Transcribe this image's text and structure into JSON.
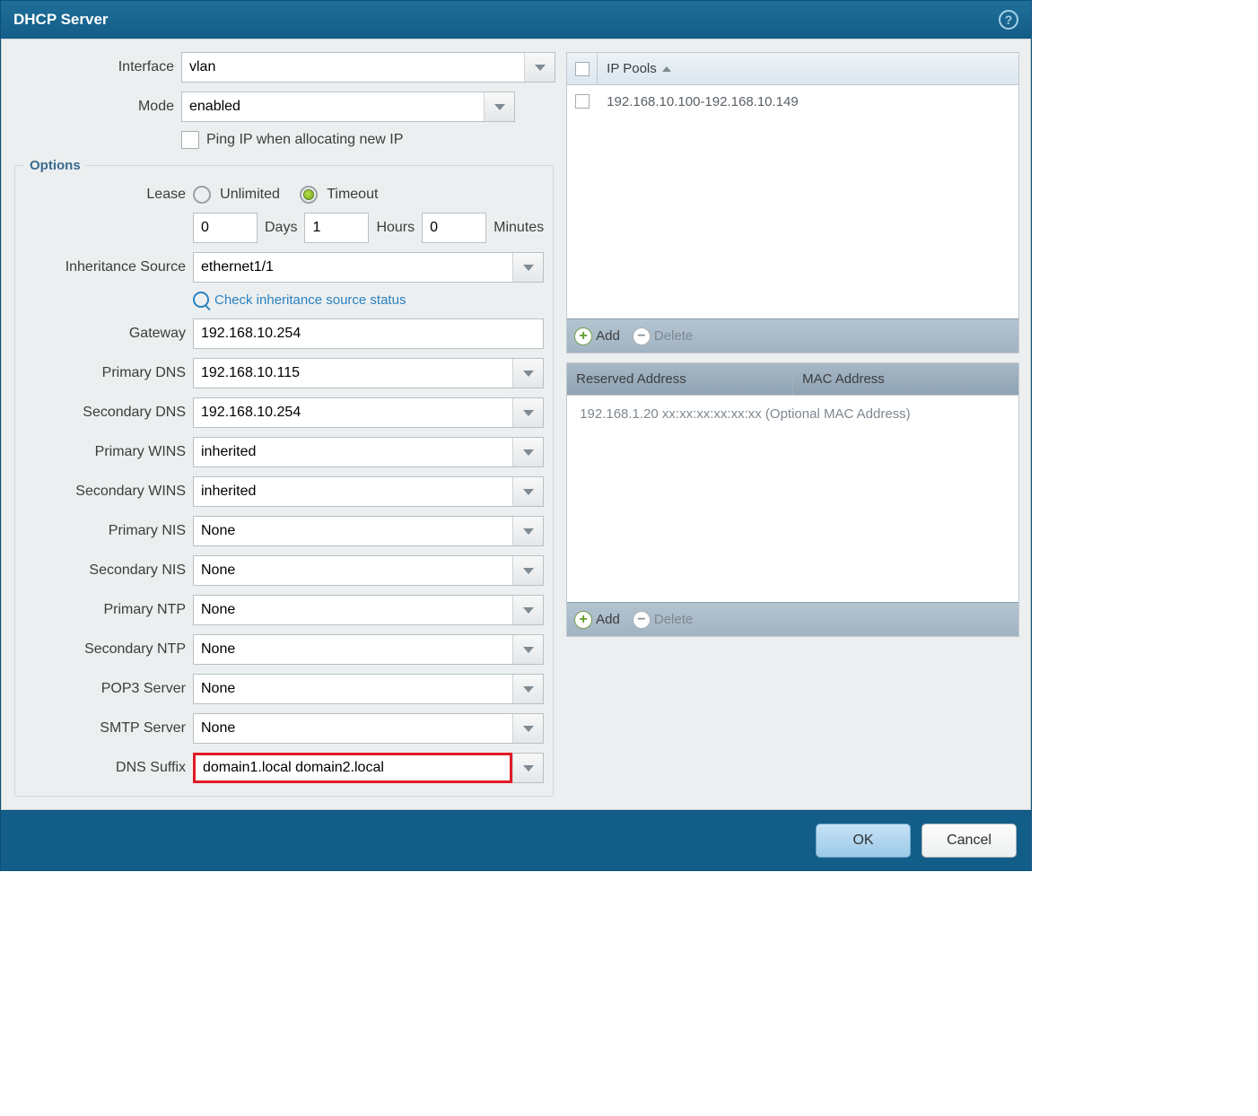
{
  "title": "DHCP Server",
  "left": {
    "interface_label": "Interface",
    "interface_value": "vlan",
    "mode_label": "Mode",
    "mode_value": "enabled",
    "ping_checkbox_label": "Ping IP when allocating new IP"
  },
  "options": {
    "legend": "Options",
    "lease_label": "Lease",
    "lease_unlimited": "Unlimited",
    "lease_timeout": "Timeout",
    "lease_selected": "Timeout",
    "days_value": "0",
    "days_label": "Days",
    "hours_value": "1",
    "hours_label": "Hours",
    "minutes_value": "0",
    "minutes_label": "Minutes",
    "inheritance_label": "Inheritance Source",
    "inheritance_value": "ethernet1/1",
    "check_link": "Check inheritance source status",
    "gateway_label": "Gateway",
    "gateway_value": "192.168.10.254",
    "primary_dns_label": "Primary DNS",
    "primary_dns_value": "192.168.10.115",
    "secondary_dns_label": "Secondary DNS",
    "secondary_dns_value": "192.168.10.254",
    "primary_wins_label": "Primary WINS",
    "primary_wins_value": "inherited",
    "secondary_wins_label": "Secondary WINS",
    "secondary_wins_value": "inherited",
    "primary_nis_label": "Primary NIS",
    "primary_nis_value": "None",
    "secondary_nis_label": "Secondary NIS",
    "secondary_nis_value": "None",
    "primary_ntp_label": "Primary NTP",
    "primary_ntp_value": "None",
    "secondary_ntp_label": "Secondary NTP",
    "secondary_ntp_value": "None",
    "pop3_label": "POP3 Server",
    "pop3_value": "None",
    "smtp_label": "SMTP Server",
    "smtp_value": "None",
    "dns_suffix_label": "DNS Suffix",
    "dns_suffix_value": "domain1.local domain2.local"
  },
  "ippools": {
    "header": "IP Pools",
    "row0": "192.168.10.100-192.168.10.149",
    "add": "Add",
    "delete": "Delete"
  },
  "reserved": {
    "col1": "Reserved Address",
    "col2": "MAC Address",
    "placeholder": "192.168.1.20 xx:xx:xx:xx:xx:xx (Optional MAC Address)",
    "add": "Add",
    "delete": "Delete"
  },
  "buttons": {
    "ok": "OK",
    "cancel": "Cancel"
  }
}
